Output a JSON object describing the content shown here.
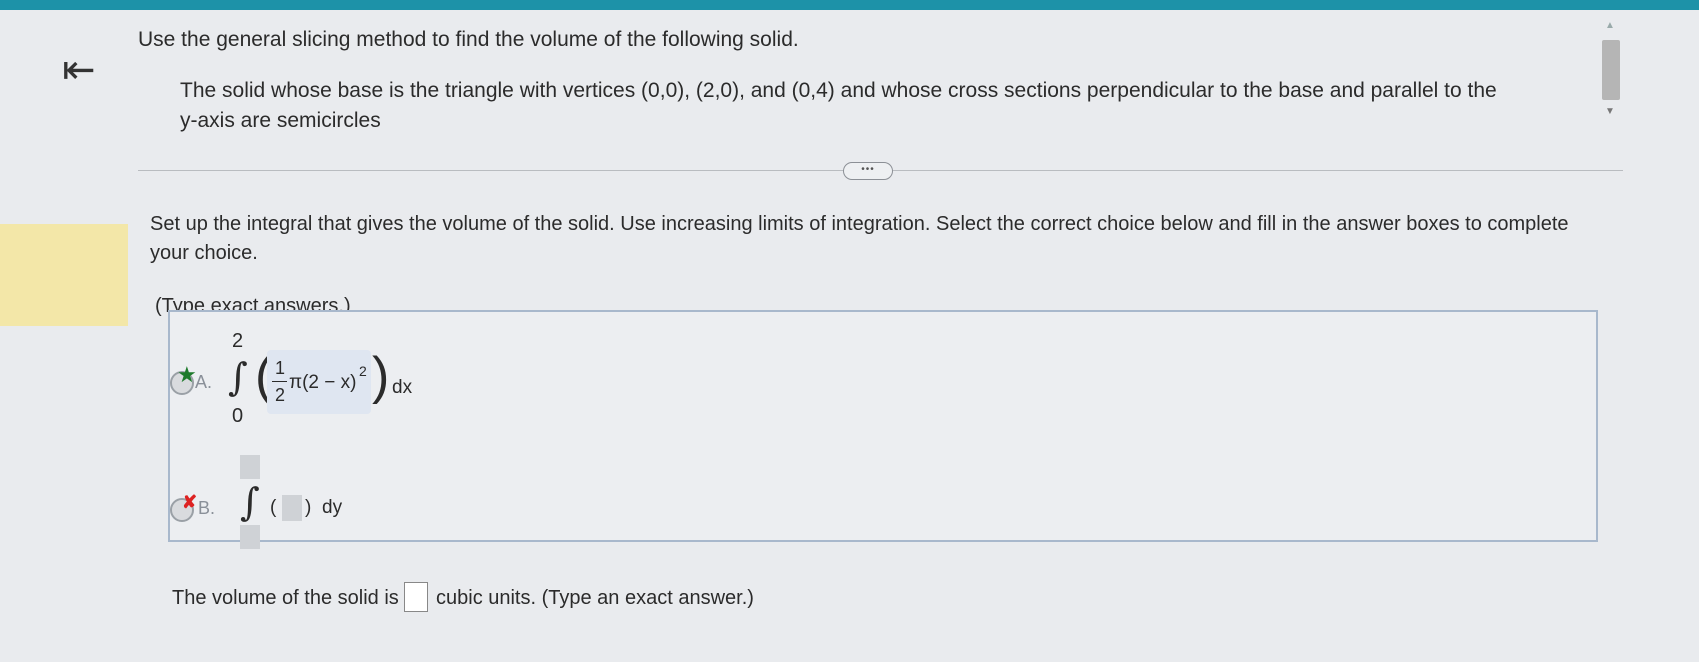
{
  "header": {
    "back_icon": "⇤"
  },
  "instruction": "Use the general slicing method to find the volume of the following solid.",
  "problem": "The solid whose base is the triangle with vertices (0,0), (2,0), and (0,4) and whose cross sections perpendicular to the base and parallel to the y-axis are semicircles",
  "divider": {
    "dots": "•••"
  },
  "setup": "Set up the integral that gives the volume of the solid. Use increasing limits of integration. Select the correct choice below and fill in the answer boxes to complete your choice.",
  "type_exact": "(Type exact answers.)",
  "choices": [
    {
      "letter": "A.",
      "upper": "2",
      "lower": "0",
      "numerator": "1",
      "denominator": "2",
      "integrand": "π(2 − x)",
      "exponent": "2",
      "differential": "dx",
      "status": "correct"
    },
    {
      "letter": "B.",
      "differential": "dy",
      "status": "incorrect"
    }
  ],
  "volume": {
    "prefix": "The volume of the solid is",
    "suffix": "cubic units. (Type an exact answer.)"
  },
  "colors": {
    "topbar": "#1d92a8",
    "highlight": "#f3e7a8",
    "correct": "#1d7a2a",
    "incorrect": "#d22222"
  }
}
